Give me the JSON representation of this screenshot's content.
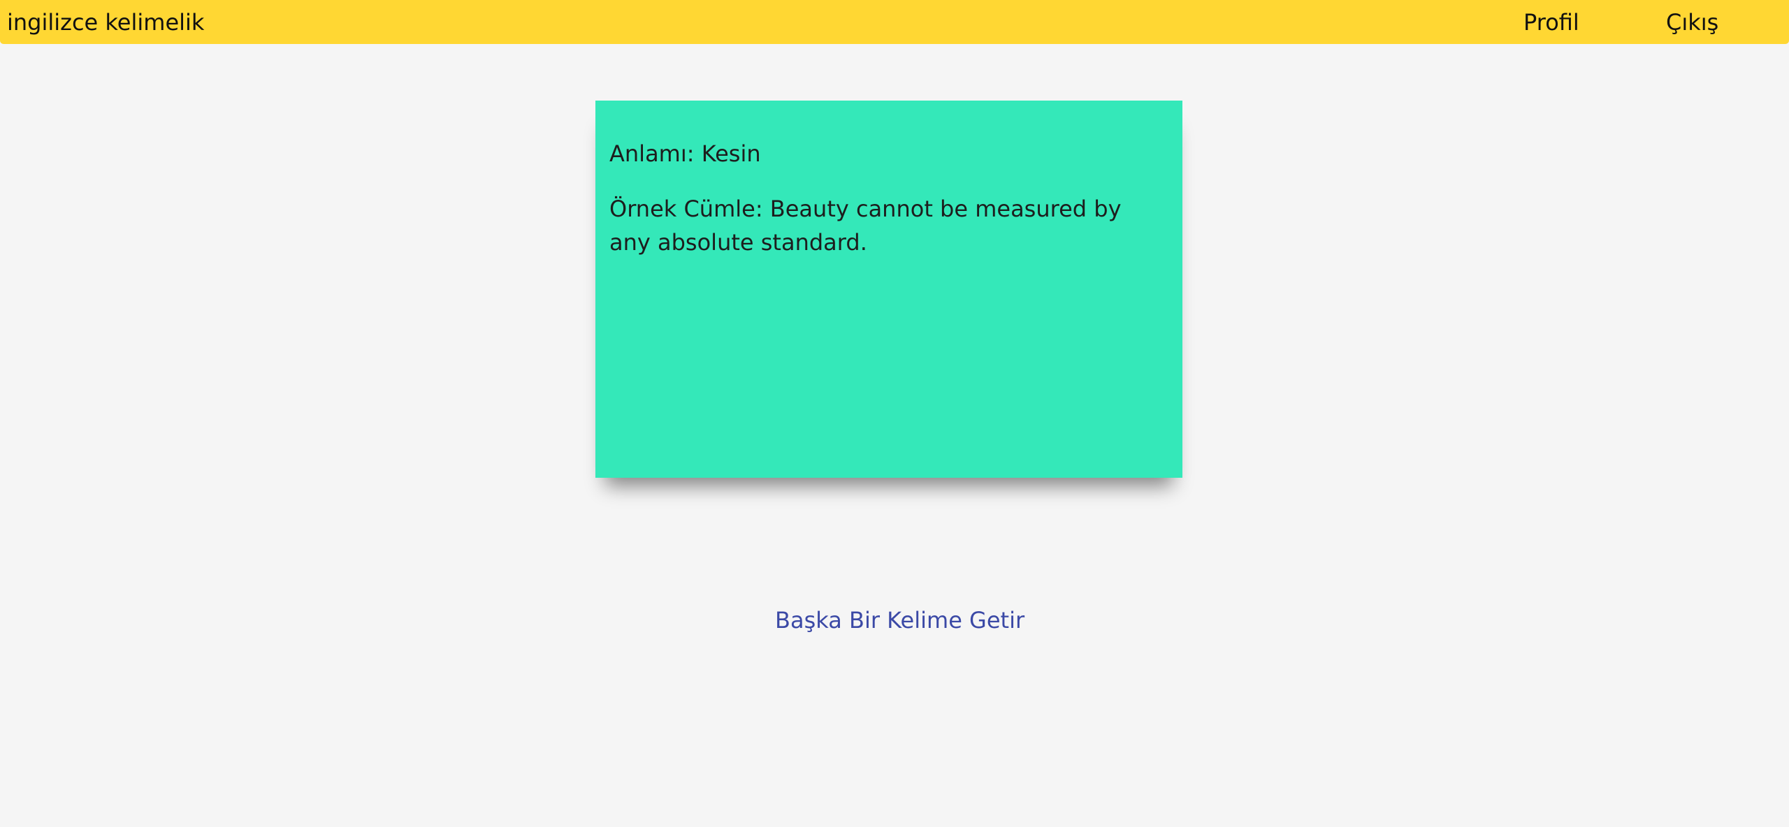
{
  "navbar": {
    "brand": "ingilizce kelimelik",
    "links": {
      "profile": "Profil",
      "logout": "Çıkış"
    }
  },
  "card": {
    "meaning_label": "Anlamı:",
    "meaning_value": "Kesin",
    "example_label": "Örnek Cümle:",
    "example_value": "Beauty cannot be measured by any absolute standard."
  },
  "actions": {
    "next_word": "Başka Bir Kelime Getir"
  },
  "colors": {
    "navbar": "#ffd733",
    "card": "#34e8b9",
    "link": "#3b49a6",
    "background": "#f5f5f5"
  }
}
